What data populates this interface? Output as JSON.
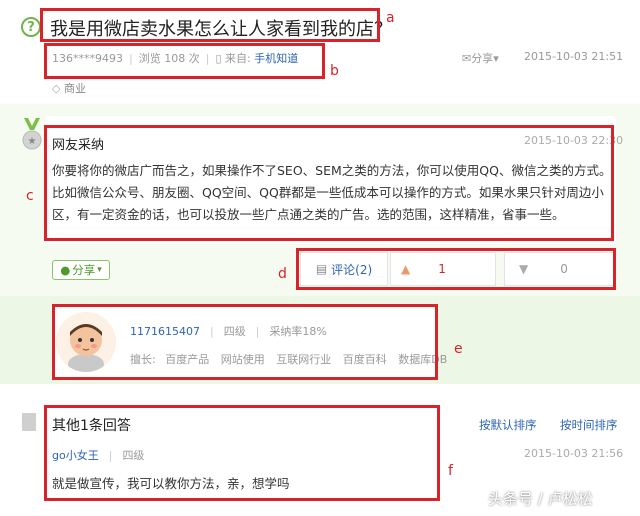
{
  "question": {
    "title": "我是用微店卖水果怎么让人家看到我的店？",
    "asker": "136****9493",
    "views": "浏览 108 次",
    "source_prefix": "来自:",
    "source": "手机知道",
    "share": "分享",
    "time": "2015-10-03 21:51",
    "tag": "商业"
  },
  "best_answer": {
    "author": "网友采纳",
    "time": "2015-10-03 22:30",
    "body": "你要将你的微店广而告之，如果操作不了SEO、SEM之类的方法，你可以使用QQ、微信之类的方式。比如微信公众号、朋友圈、QQ空间、QQ群都是一些低成本可以操作的方式。如果水果只针对周边小区，有一定资金的话，也可以投放一些广点通之类的广告。选的范围，这样精准，省事一些。",
    "share": "分享",
    "comments": "评论(2)",
    "likes": "1",
    "dislikes": "0"
  },
  "answerer": {
    "id": "1171615407",
    "level": "四级",
    "adoption": "采纳率18%",
    "expertise_label": "擅长:",
    "expertise": [
      "百度产品",
      "网站使用",
      "互联网行业",
      "百度百科",
      "数据库DB"
    ]
  },
  "other_answers": {
    "title": "其他1条回答",
    "sort_default": "按默认排序",
    "sort_time": "按时间排序",
    "items": [
      {
        "user": "go小女王",
        "level": "四级",
        "time": "2015-10-03 21:56",
        "body": "就是做宣传，我可以教你方法，亲，想学吗"
      }
    ]
  },
  "annotations": [
    "a",
    "b",
    "c",
    "d",
    "e",
    "f"
  ],
  "watermark": "头条号 / 卢松松",
  "colors": {
    "annotation_red": "#d8232a",
    "link_blue": "#2d64b3",
    "accent_green": "#70b549",
    "best_bg": "#f5fbf1"
  }
}
